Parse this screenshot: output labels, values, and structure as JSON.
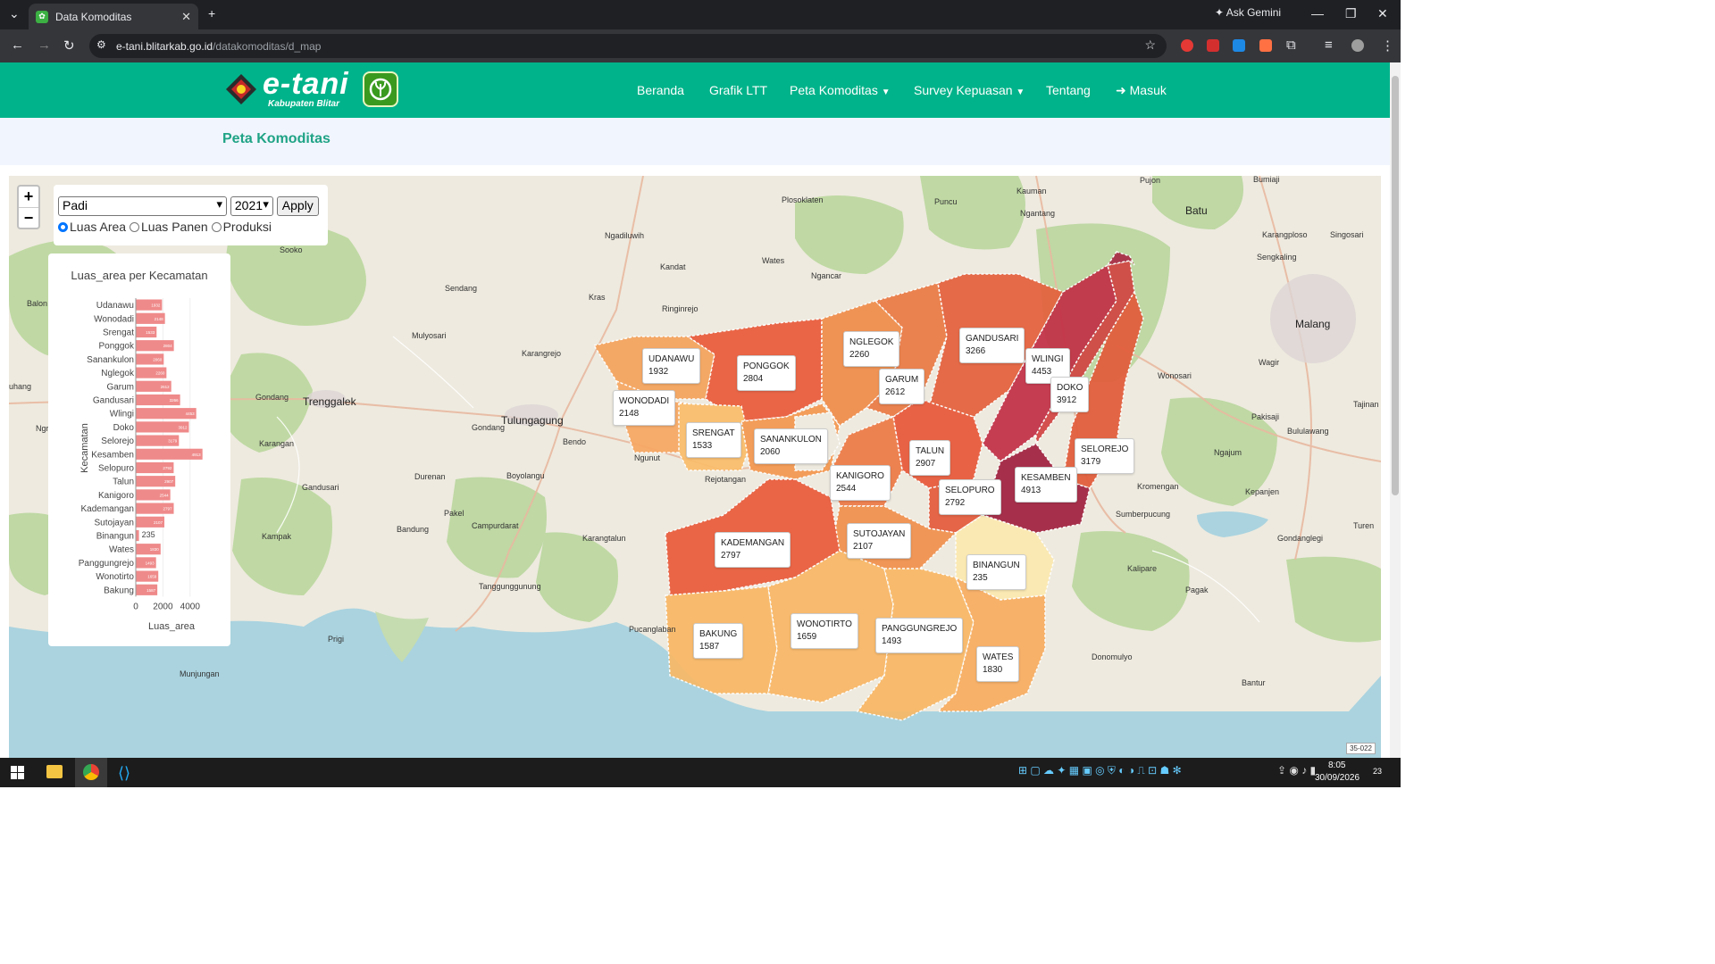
{
  "browser": {
    "tab_title": "Data Komoditas",
    "url_host": "e-tani.blitarkab.go.id",
    "url_path": "/datakomoditas/d_map",
    "ask_gemini": "Ask Gemini"
  },
  "site": {
    "logo_text": "e-tani",
    "logo_sub": "Kabupaten Blitar",
    "nav": [
      "Beranda",
      "Grafik LTT",
      "Peta Komoditas",
      "Survey Kepuasan",
      "Tentang",
      "Masuk"
    ],
    "page_title": "Peta Komoditas"
  },
  "controls": {
    "commodity": "Padi",
    "year": "2021",
    "apply_label": "Apply",
    "radio_options": [
      "Luas Area",
      "Luas Panen",
      "Produksi"
    ],
    "radio_selected": "Luas Area"
  },
  "map_labels": [
    {
      "name": "UDANAWU",
      "value": "1932"
    },
    {
      "name": "PONGGOK",
      "value": "2804"
    },
    {
      "name": "NGLEGOK",
      "value": "2260"
    },
    {
      "name": "GANDUSARI",
      "value": "3266"
    },
    {
      "name": "WLINGI",
      "value": "4453"
    },
    {
      "name": "DOKO",
      "value": "3912"
    },
    {
      "name": "GARUM",
      "value": "2612"
    },
    {
      "name": "WONODADI",
      "value": "2148"
    },
    {
      "name": "SRENGAT",
      "value": "1533"
    },
    {
      "name": "SANANKULON",
      "value": "2060"
    },
    {
      "name": "TALUN",
      "value": "2907"
    },
    {
      "name": "SELOREJO",
      "value": "3179"
    },
    {
      "name": "KANIGORO",
      "value": "2544"
    },
    {
      "name": "KESAMBEN",
      "value": "4913"
    },
    {
      "name": "SELOPURO",
      "value": "2792"
    },
    {
      "name": "SUTOJAYAN",
      "value": "2107"
    },
    {
      "name": "KADEMANGAN",
      "value": "2797"
    },
    {
      "name": "BINANGUN",
      "value": "235"
    },
    {
      "name": "BAKUNG",
      "value": "1587"
    },
    {
      "name": "WONOTIRTO",
      "value": "1659"
    },
    {
      "name": "PANGGUNGREJO",
      "value": "1493"
    },
    {
      "name": "WATES",
      "value": "1830"
    }
  ],
  "places": [
    "Sooko",
    "Sendang",
    "Mulyosari",
    "Balon",
    "Ngadiluwih",
    "Kandat",
    "Plosoklaten",
    "Puncu",
    "Kauman",
    "Ngantang",
    "Pujon",
    "Bumiaji",
    "Batu",
    "Karangploso",
    "Singosari",
    "Sengkaling",
    "Malang",
    "Wagir",
    "Wates",
    "Ngancar",
    "Kras",
    "Ringinrejo",
    "Karangrejo",
    "Trenggalek",
    "Gondang",
    "Tulungagung",
    "Gondang",
    "Bendo",
    "Ngunut",
    "Rejotangan",
    "Karangan",
    "Durenan",
    "Boyolangu",
    "Gandusari",
    "Pakel",
    "Campurdarat",
    "Bandung",
    "Kampak",
    "Karangtalun",
    "Tanggunggunung",
    "Pucanglaban",
    "Munjungan",
    "Prigi",
    "Wonosari",
    "Pakisaji",
    "Tajinan",
    "Bululawang",
    "Ngajum",
    "Kromengan",
    "Kepanjen",
    "Sumberpucung",
    "Kalipare",
    "Pagak",
    "Gondanglegi",
    "Turen",
    "Donomulyo",
    "Bantur",
    "Ngr",
    "uhang"
  ],
  "chart_data": {
    "type": "bar",
    "orientation": "horizontal",
    "title": "Luas_area per Kecamatan",
    "xlabel": "Luas_area",
    "ylabel": "Kecamatan",
    "xlim": [
      0,
      5000
    ],
    "xticks": [
      "0",
      "2000",
      "4000"
    ],
    "color": "#ef8a8a",
    "categories": [
      "Udanawu",
      "Wonodadi",
      "Srengat",
      "Ponggok",
      "Sanankulon",
      "Nglegok",
      "Garum",
      "Gandusari",
      "Wlingi",
      "Doko",
      "Selorejo",
      "Kesamben",
      "Selopuro",
      "Talun",
      "Kanigoro",
      "Kademangan",
      "Sutojayan",
      "Binangun",
      "Wates",
      "Panggungrejo",
      "Wonotirto",
      "Bakung"
    ],
    "values": [
      1932,
      2148,
      1533,
      2804,
      2060,
      2260,
      2612,
      3266,
      4453,
      3912,
      3179,
      4913,
      2792,
      2907,
      2544,
      2797,
      2107,
      235,
      1830,
      1493,
      1659,
      1587
    ]
  },
  "map_badge": "35-022",
  "taskbar": {
    "time": "8:05",
    "date": "30/09/2026",
    "notif": "23"
  }
}
